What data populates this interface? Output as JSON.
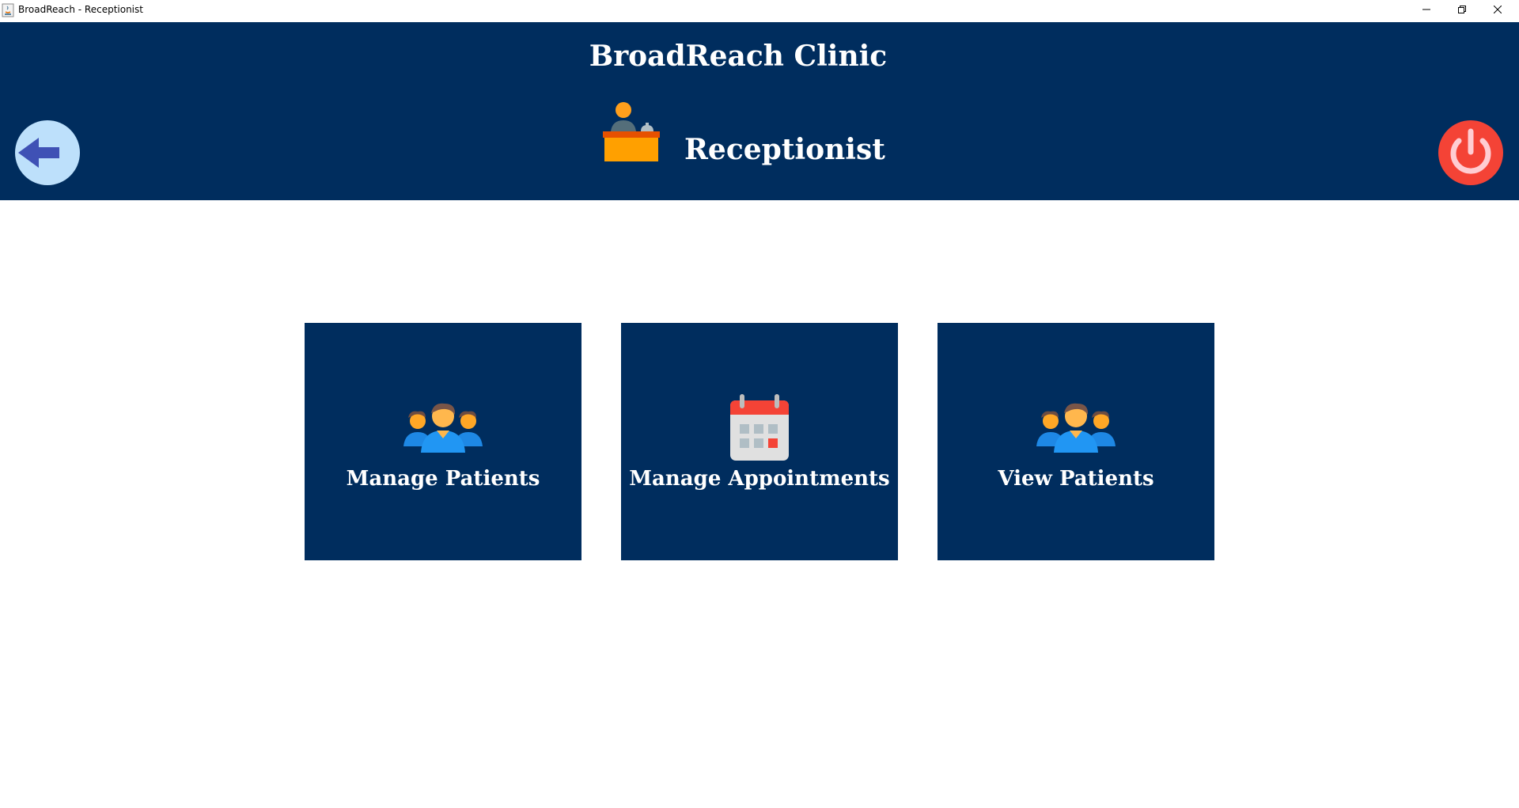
{
  "window": {
    "title": "BroadReach - Receptionist",
    "controls": [
      "minimize-icon",
      "restore-icon",
      "close-icon"
    ]
  },
  "header": {
    "clinic_name": "BroadReach Clinic",
    "role_label": "Receptionist",
    "role_icon": "receptionist-desk-icon",
    "back_icon": "back-arrow-icon",
    "power_icon": "power-icon",
    "colors": {
      "background": "#002d5e",
      "back_button": "#bde0fb",
      "back_arrow": "#3f51b5",
      "power_button": "#f44336",
      "role_desk": "#ff9800"
    }
  },
  "tiles": [
    {
      "label": "Manage Patients",
      "icon": "people-group-icon"
    },
    {
      "label": "Manage Appointments",
      "icon": "calendar-icon"
    },
    {
      "label": "View Patients",
      "icon": "people-group-icon"
    }
  ],
  "colors": {
    "tile_background": "#002d5e",
    "page_background": "#ffffff",
    "text": "#ffffff"
  }
}
